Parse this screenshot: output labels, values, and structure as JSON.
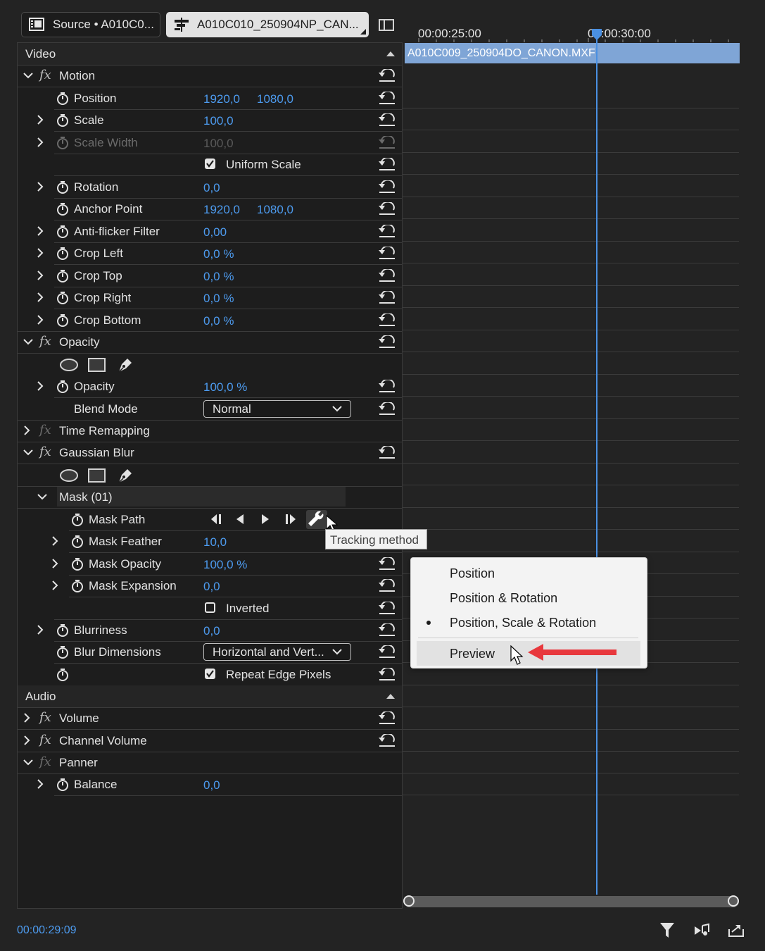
{
  "tabs": {
    "source_label": "Source • A010C0...",
    "sequence_label": "A010C010_250904NP_CAN..."
  },
  "timeline": {
    "ruler_labels": [
      "00:00:25:00",
      "00:00:30:00"
    ],
    "clip_name": "A010C009_250904DO_CANON.MXF",
    "timecode": "00:00:29:09"
  },
  "sections": {
    "video": "Video",
    "audio": "Audio"
  },
  "motion": {
    "title": "Motion",
    "position": {
      "label": "Position",
      "x": "1920,0",
      "y": "1080,0"
    },
    "scale": {
      "label": "Scale",
      "value": "100,0"
    },
    "scale_width": {
      "label": "Scale Width",
      "value": "100,0"
    },
    "uniform_scale": {
      "label": "Uniform Scale",
      "checked": true
    },
    "rotation": {
      "label": "Rotation",
      "value": "0,0"
    },
    "anchor_point": {
      "label": "Anchor Point",
      "x": "1920,0",
      "y": "1080,0"
    },
    "anti_flicker": {
      "label": "Anti-flicker Filter",
      "value": "0,00"
    },
    "crop_left": {
      "label": "Crop Left",
      "value": "0,0 %"
    },
    "crop_top": {
      "label": "Crop Top",
      "value": "0,0 %"
    },
    "crop_right": {
      "label": "Crop Right",
      "value": "0,0 %"
    },
    "crop_bottom": {
      "label": "Crop Bottom",
      "value": "0,0 %"
    }
  },
  "opacity": {
    "title": "Opacity",
    "opacity": {
      "label": "Opacity",
      "value": "100,0 %"
    },
    "blend_mode": {
      "label": "Blend Mode",
      "value": "Normal"
    }
  },
  "time_remapping": {
    "title": "Time Remapping"
  },
  "gaussian_blur": {
    "title": "Gaussian Blur",
    "mask": {
      "title": "Mask (01)"
    },
    "mask_path": {
      "label": "Mask Path"
    },
    "mask_feather": {
      "label": "Mask Feather",
      "value": "10,0"
    },
    "mask_opacity": {
      "label": "Mask Opacity",
      "value": "100,0 %"
    },
    "mask_expansion": {
      "label": "Mask Expansion",
      "value": "0,0"
    },
    "inverted": {
      "label": "Inverted",
      "checked": false
    },
    "blurriness": {
      "label": "Blurriness",
      "value": "0,0"
    },
    "blur_dimensions": {
      "label": "Blur Dimensions",
      "value": "Horizontal and Vert..."
    },
    "repeat_edge": {
      "label": "Repeat Edge Pixels",
      "checked": true
    }
  },
  "audio": {
    "volume": {
      "title": "Volume"
    },
    "channel_volume": {
      "title": "Channel Volume"
    },
    "panner": {
      "title": "Panner"
    },
    "balance": {
      "label": "Balance",
      "value": "0,0"
    }
  },
  "tooltip": "Tracking method",
  "context_menu": {
    "items": [
      "Position",
      "Position & Rotation",
      "Position, Scale & Rotation",
      "Preview"
    ],
    "selected_index": 2,
    "hovered_index": 3
  },
  "colors": {
    "accent": "#4d9bef",
    "clip": "#7fa5d6",
    "arrow": "#e8383d"
  }
}
